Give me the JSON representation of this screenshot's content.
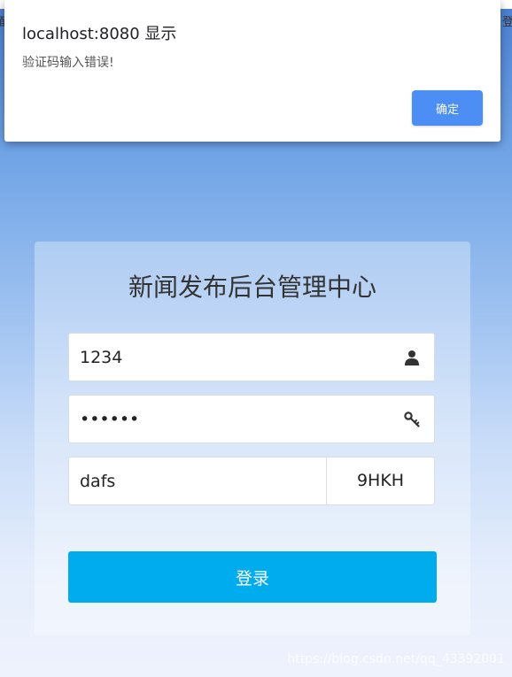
{
  "page": {
    "edge_left_text": "面",
    "edge_right_text": "登"
  },
  "alert": {
    "title": "localhost:8080 显示",
    "message": "验证码输入错误!",
    "ok_label": "确定"
  },
  "login": {
    "title": "新闻发布后台管理中心",
    "username_value": "1234",
    "password_value": "123456",
    "captcha_value": "dafs",
    "captcha_code": "9HKH",
    "submit_label": "登录",
    "username_icon": "user-icon",
    "password_icon": "key-icon"
  },
  "watermark": "https://blog.csdn.net/qq_43392001",
  "colors": {
    "accent": "#00abee",
    "alert_button": "#4d8ef5"
  }
}
